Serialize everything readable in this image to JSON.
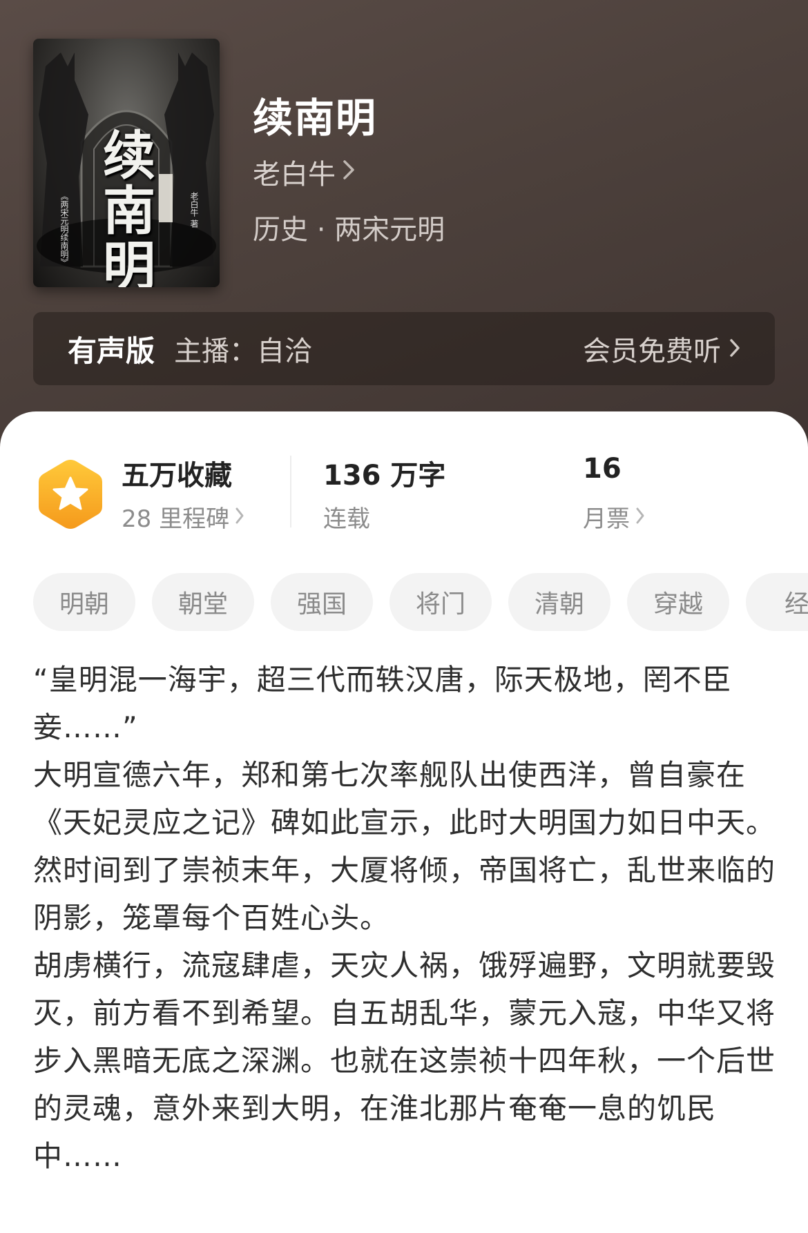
{
  "book": {
    "title": "续南明",
    "author": "老白牛",
    "genre": "历史 · 两宋元明",
    "cover": {
      "title_chars": [
        "续",
        "南",
        "明"
      ],
      "subtitle": "《两宋元明续南明》",
      "author": "老白牛 著"
    }
  },
  "audio": {
    "label": "有声版",
    "host": "主播：自洽",
    "listen": "会员免费听"
  },
  "stats": {
    "favorites": "五万收藏",
    "milestones": "28 里程碑",
    "words": "136 万字",
    "status": "连载",
    "tickets": "16",
    "tickets_label": "月票"
  },
  "tags": [
    "明朝",
    "朝堂",
    "强国",
    "将门",
    "清朝",
    "穿越",
    "经"
  ],
  "synopsis": [
    "“皇明混一海宇，超三代而轶汉唐，际天极地，罔不臣妾……”",
    "大明宣德六年，郑和第七次率舰队出使西洋，曾自豪在《天妃灵应之记》碑如此宣示，此时大明国力如日中天。",
    "然时间到了崇祯末年，大厦将倾，帝国将亡，乱世来临的阴影，笼罩每个百姓心头。",
    "胡虏横行，流寇肆虐，天灾人祸，饿殍遍野，文明就要毁灭，前方看不到希望。自五胡乱华，蒙元入寇，中华又将步入黑暗无底之深渊。也就在这崇祯十四年秋，一个后世的灵魂，意外来到大明，在淮北那片奄奄一息的饥民中……"
  ],
  "colors": {
    "header_bg": "#4d413c",
    "badge_top": "#ffc93a",
    "badge_bottom": "#f59a1c"
  },
  "icons": {
    "chevron": "chevron-right-icon",
    "badge": "star-badge-icon"
  }
}
